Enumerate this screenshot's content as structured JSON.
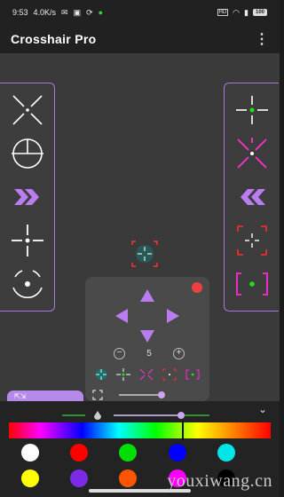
{
  "status": {
    "time": "9:53",
    "speed": "4.0K/s",
    "battery": "100",
    "icons": [
      "wechat-icon",
      "notification-icon",
      "sync-icon",
      "green-dot-icon",
      "volte-icon",
      "wifi-icon",
      "signal-icon",
      "battery-icon"
    ]
  },
  "app": {
    "title": "Crosshair Pro",
    "menu": "⋮"
  },
  "left_panel": {
    "items": [
      "x-cross-crosshair",
      "circle-scope-crosshair",
      "chevron-right-crosshair",
      "gap-cross-crosshair",
      "circle-dot-crosshair"
    ]
  },
  "right_panel": {
    "items": [
      "green-dot-cross-crosshair",
      "magenta-x-crosshair",
      "chevron-left-crosshair",
      "red-bracket-crosshair",
      "magenta-bracket-crosshair"
    ]
  },
  "controls": {
    "zoom_value": "5",
    "zoom_minus": "−",
    "zoom_plus": "+",
    "tab_label": "⇱⇲"
  },
  "colors": {
    "accent": "#a877e0",
    "swatches": [
      "#ffffff",
      "#ff0000",
      "#00dd00",
      "#0000ff",
      "#00e5e5",
      "#ffff00",
      "#7b2ae8",
      "#ff5500",
      "#ff00ff",
      "#000000"
    ]
  },
  "watermark": "youxiwang.cn"
}
